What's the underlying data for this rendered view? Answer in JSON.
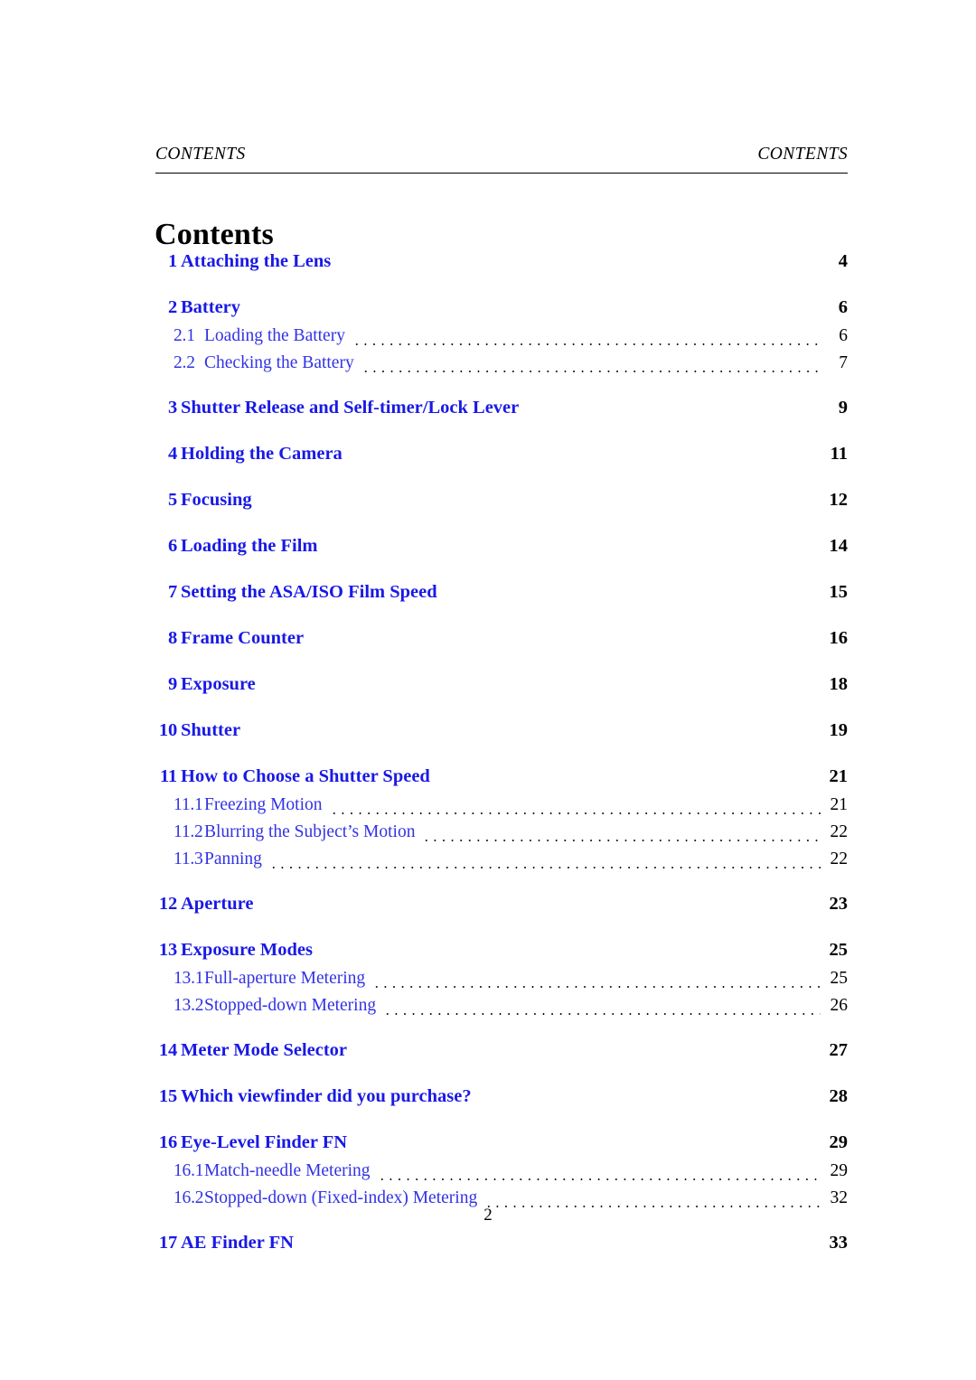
{
  "header": {
    "left": "CONTENTS",
    "right": "CONTENTS"
  },
  "title": "Contents",
  "footer": {
    "page_number": "2"
  },
  "colors": {
    "section_link": "#1919e6",
    "subsection_link": "#3232e6",
    "page_number": "#000000",
    "leader_dots": "#000000",
    "rule": "#000000",
    "background": "#ffffff"
  },
  "toc": {
    "entries": [
      {
        "level": 1,
        "number": "1",
        "title": "Attaching the Lens",
        "page": "4",
        "leader": false
      },
      {
        "level": 1,
        "number": "2",
        "title": "Battery",
        "page": "6",
        "leader": false
      },
      {
        "level": 2,
        "number": "2.1",
        "title": "Loading the Battery",
        "page": "6",
        "leader": true
      },
      {
        "level": 2,
        "number": "2.2",
        "title": "Checking the Battery",
        "page": "7",
        "leader": true
      },
      {
        "level": 1,
        "number": "3",
        "title": "Shutter Release and Self-timer/Lock Lever",
        "page": "9",
        "leader": false
      },
      {
        "level": 1,
        "number": "4",
        "title": "Holding the Camera",
        "page": "11",
        "leader": false
      },
      {
        "level": 1,
        "number": "5",
        "title": "Focusing",
        "page": "12",
        "leader": false
      },
      {
        "level": 1,
        "number": "6",
        "title": "Loading the Film",
        "page": "14",
        "leader": false
      },
      {
        "level": 1,
        "number": "7",
        "title": "Setting the ASA/ISO Film Speed",
        "page": "15",
        "leader": false
      },
      {
        "level": 1,
        "number": "8",
        "title": "Frame Counter",
        "page": "16",
        "leader": false
      },
      {
        "level": 1,
        "number": "9",
        "title": "Exposure",
        "page": "18",
        "leader": false
      },
      {
        "level": 1,
        "number": "10",
        "title": "Shutter",
        "page": "19",
        "leader": false
      },
      {
        "level": 1,
        "number": "11",
        "title": "How to Choose a Shutter Speed",
        "page": "21",
        "leader": false
      },
      {
        "level": 2,
        "number": "11.1",
        "title": "Freezing Motion",
        "page": "21",
        "leader": true
      },
      {
        "level": 2,
        "number": "11.2",
        "title": "Blurring the Subject’s Motion",
        "page": "22",
        "leader": true
      },
      {
        "level": 2,
        "number": "11.3",
        "title": "Panning",
        "page": "22",
        "leader": true
      },
      {
        "level": 1,
        "number": "12",
        "title": "Aperture",
        "page": "23",
        "leader": false
      },
      {
        "level": 1,
        "number": "13",
        "title": "Exposure Modes",
        "page": "25",
        "leader": false
      },
      {
        "level": 2,
        "number": "13.1",
        "title": "Full-aperture Metering",
        "page": "25",
        "leader": true
      },
      {
        "level": 2,
        "number": "13.2",
        "title": "Stopped-down Metering",
        "page": "26",
        "leader": true
      },
      {
        "level": 1,
        "number": "14",
        "title": "Meter Mode Selector",
        "page": "27",
        "leader": false
      },
      {
        "level": 1,
        "number": "15",
        "title": "Which viewfinder did you purchase?",
        "page": "28",
        "leader": false
      },
      {
        "level": 1,
        "number": "16",
        "title": "Eye-Level Finder FN",
        "page": "29",
        "leader": false
      },
      {
        "level": 2,
        "number": "16.1",
        "title": "Match-needle Metering",
        "page": "29",
        "leader": true
      },
      {
        "level": 2,
        "number": "16.2",
        "title": "Stopped-down (Fixed-index) Metering",
        "page": "32",
        "leader": true
      },
      {
        "level": 1,
        "number": "17",
        "title": "AE Finder FN",
        "page": "33",
        "leader": false
      }
    ]
  }
}
